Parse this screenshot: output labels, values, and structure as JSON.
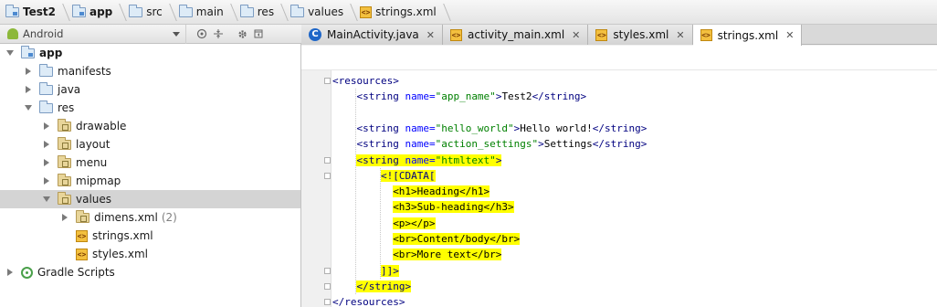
{
  "breadcrumb": [
    {
      "label": "Test2",
      "icon": "module-folder-icon",
      "bold": true
    },
    {
      "label": "app",
      "icon": "module-folder-icon",
      "bold": true
    },
    {
      "label": "src",
      "icon": "folder-icon",
      "bold": false
    },
    {
      "label": "main",
      "icon": "folder-icon",
      "bold": false
    },
    {
      "label": "res",
      "icon": "folder-icon",
      "bold": false
    },
    {
      "label": "values",
      "icon": "folder-icon",
      "bold": false
    },
    {
      "label": "strings.xml",
      "icon": "xml-file-icon",
      "bold": false
    }
  ],
  "project_panel": {
    "view_selector": "Android",
    "toolbar_icons": [
      "target-icon",
      "collapse-all-icon",
      "gear-icon",
      "hide-panel-icon"
    ],
    "tree": [
      {
        "label": "app",
        "depth": 0,
        "expanded": true,
        "icon": "module-folder-icon",
        "bold": true
      },
      {
        "label": "manifests",
        "depth": 1,
        "expanded": false,
        "icon": "folder-icon"
      },
      {
        "label": "java",
        "depth": 1,
        "expanded": false,
        "icon": "folder-icon"
      },
      {
        "label": "res",
        "depth": 1,
        "expanded": true,
        "icon": "folder-icon"
      },
      {
        "label": "drawable",
        "depth": 2,
        "expanded": false,
        "icon": "res-folder-icon"
      },
      {
        "label": "layout",
        "depth": 2,
        "expanded": false,
        "icon": "res-folder-icon"
      },
      {
        "label": "menu",
        "depth": 2,
        "expanded": false,
        "icon": "res-folder-icon"
      },
      {
        "label": "mipmap",
        "depth": 2,
        "expanded": false,
        "icon": "res-folder-icon"
      },
      {
        "label": "values",
        "depth": 2,
        "expanded": true,
        "icon": "res-folder-icon",
        "selected": true
      },
      {
        "label": "dimens.xml",
        "meta": "(2)",
        "depth": 3,
        "expanded": false,
        "icon": "res-folder-icon"
      },
      {
        "label": "strings.xml",
        "depth": 3,
        "leaf": true,
        "icon": "xml-file-icon"
      },
      {
        "label": "styles.xml",
        "depth": 3,
        "leaf": true,
        "icon": "xml-file-icon"
      },
      {
        "label": "Gradle Scripts",
        "depth": 0,
        "expanded": false,
        "icon": "gradle-icon"
      }
    ]
  },
  "editor_tabs": [
    {
      "label": "MainActivity.java",
      "icon": "java-class-icon",
      "active": false
    },
    {
      "label": "activity_main.xml",
      "icon": "xml-file-icon",
      "active": false
    },
    {
      "label": "styles.xml",
      "icon": "xml-file-icon",
      "active": false
    },
    {
      "label": "strings.xml",
      "icon": "xml-file-icon",
      "active": true
    }
  ],
  "code_lines": [
    {
      "indent": 0,
      "highlight": false,
      "parts": [
        {
          "t": "tag",
          "s": "<resources>"
        }
      ]
    },
    {
      "indent": 4,
      "highlight": false,
      "parts": [
        {
          "t": "tag",
          "s": "<string "
        },
        {
          "t": "attr",
          "s": "name="
        },
        {
          "t": "val",
          "s": "\"app_name\""
        },
        {
          "t": "tag",
          "s": ">"
        },
        {
          "t": "txt",
          "s": "Test2"
        },
        {
          "t": "tag",
          "s": "</string>"
        }
      ]
    },
    {
      "indent": 0,
      "highlight": false,
      "parts": []
    },
    {
      "indent": 4,
      "highlight": false,
      "parts": [
        {
          "t": "tag",
          "s": "<string "
        },
        {
          "t": "attr",
          "s": "name="
        },
        {
          "t": "val",
          "s": "\"hello_world\""
        },
        {
          "t": "tag",
          "s": ">"
        },
        {
          "t": "txt",
          "s": "Hello world!"
        },
        {
          "t": "tag",
          "s": "</string>"
        }
      ]
    },
    {
      "indent": 4,
      "highlight": false,
      "parts": [
        {
          "t": "tag",
          "s": "<string "
        },
        {
          "t": "attr",
          "s": "name="
        },
        {
          "t": "val",
          "s": "\"action_settings\""
        },
        {
          "t": "tag",
          "s": ">"
        },
        {
          "t": "txt",
          "s": "Settings"
        },
        {
          "t": "tag",
          "s": "</string>"
        }
      ]
    },
    {
      "indent": 4,
      "highlight": true,
      "parts": [
        {
          "t": "tag",
          "s": "<string "
        },
        {
          "t": "attr",
          "s": "name="
        },
        {
          "t": "val",
          "s": "\"htmltext\""
        },
        {
          "t": "tag",
          "s": ">"
        }
      ]
    },
    {
      "indent": 8,
      "highlight": true,
      "parts": [
        {
          "t": "tag",
          "s": "<![CDATA["
        }
      ]
    },
    {
      "indent": 10,
      "highlight": true,
      "parts": [
        {
          "t": "txt",
          "s": "<h1>Heading</h1>"
        }
      ]
    },
    {
      "indent": 10,
      "highlight": true,
      "parts": [
        {
          "t": "txt",
          "s": "<h3>Sub-heading</h3>"
        }
      ]
    },
    {
      "indent": 10,
      "highlight": true,
      "parts": [
        {
          "t": "txt",
          "s": "<p></p>"
        }
      ]
    },
    {
      "indent": 10,
      "highlight": true,
      "parts": [
        {
          "t": "txt",
          "s": "<br>Content/body</br>"
        }
      ]
    },
    {
      "indent": 10,
      "highlight": true,
      "parts": [
        {
          "t": "txt",
          "s": "<br>More text</br>"
        }
      ]
    },
    {
      "indent": 8,
      "highlight": true,
      "parts": [
        {
          "t": "tag",
          "s": "]]>"
        }
      ]
    },
    {
      "indent": 4,
      "highlight": true,
      "parts": [
        {
          "t": "tag",
          "s": "</string>"
        }
      ]
    },
    {
      "indent": 0,
      "highlight": false,
      "parts": [
        {
          "t": "tag",
          "s": "</resources>"
        }
      ]
    }
  ],
  "colors": {
    "highlight": "#ffff00",
    "tag": "#000080",
    "attribute": "#0000ff",
    "value": "#008000",
    "selection": "#d4d4d4"
  }
}
